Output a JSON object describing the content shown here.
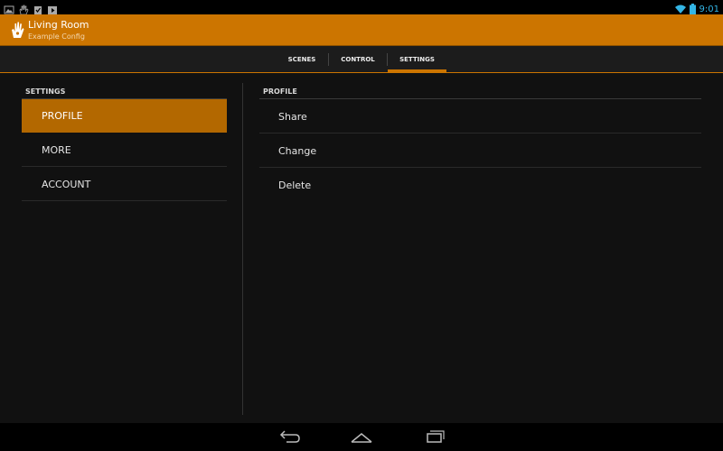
{
  "status_bar": {
    "time": "9:01",
    "left_icons": [
      "picture-icon",
      "hand-icon",
      "check-clipboard-icon",
      "play-icon"
    ],
    "right_icons": [
      "wifi-icon",
      "battery-icon"
    ],
    "accent_color": "#33b5e5"
  },
  "action_bar": {
    "title": "Living Room",
    "subtitle": "Example Config",
    "app_icon": "hand-icon",
    "color": "#cc7500"
  },
  "tabs": [
    {
      "label": "SCENES",
      "selected": false
    },
    {
      "label": "CONTROL",
      "selected": false
    },
    {
      "label": "SETTINGS",
      "selected": true
    }
  ],
  "settings": {
    "header": "SETTINGS",
    "items": [
      {
        "label": "PROFILE",
        "selected": true
      },
      {
        "label": "MORE",
        "selected": false
      },
      {
        "label": "ACCOUNT",
        "selected": false
      }
    ]
  },
  "profile": {
    "header": "PROFILE",
    "options": [
      {
        "label": "Share"
      },
      {
        "label": "Change"
      },
      {
        "label": "Delete"
      }
    ]
  },
  "nav_bar": {
    "buttons": [
      "back-icon",
      "home-icon",
      "recent-apps-icon"
    ]
  }
}
